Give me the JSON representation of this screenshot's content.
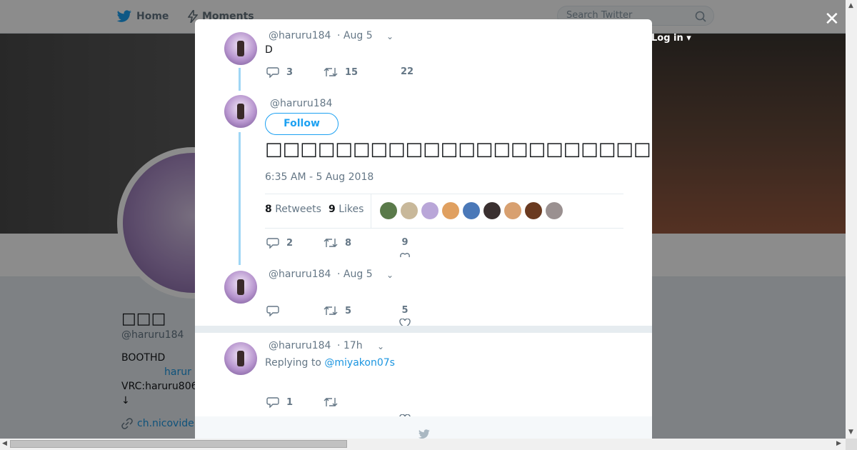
{
  "nav": {
    "home": "Home",
    "moments": "Moments",
    "search_placeholder": "Search Twitter",
    "login": "Log in"
  },
  "profile": {
    "name": "□□□",
    "handle": "@haruru184",
    "bio_line1": "BOOTHD",
    "bio_link": "harur",
    "bio_line3": "VRC:haruru806",
    "bio_line4": "↓",
    "url": "ch.nicovide"
  },
  "modal": {
    "tweet1": {
      "handle": "@haruru184",
      "time": "· Aug 5",
      "text": "D",
      "replies": "3",
      "retweets": "15",
      "likes": "22"
    },
    "main": {
      "handle": "@haruru184",
      "follow_label": "Follow",
      "text": "□□□□□□□□□□□□□□□□□□□□□□□□□□□□□□□□□□□□□□□",
      "date": "6:35 AM - 5 Aug 2018",
      "retweets_count": "8",
      "retweets_label": "Retweets",
      "likes_count": "9",
      "likes_label": "Likes",
      "replies": "2",
      "rt_action": "8",
      "like_action": "9"
    },
    "tweet3": {
      "handle": "@haruru184",
      "time": "· Aug 5",
      "replies": "",
      "retweets": "5",
      "likes": "5"
    },
    "tweet4": {
      "handle": "@haruru184",
      "time": "· 17h",
      "replying_prefix": "Replying to",
      "replying_to": "@miyakon07s",
      "replies": "1",
      "retweets": ""
    }
  },
  "colors": {
    "accent": "#1da1f2",
    "thread_line": "#9fd6f5",
    "muted": "#657786"
  }
}
